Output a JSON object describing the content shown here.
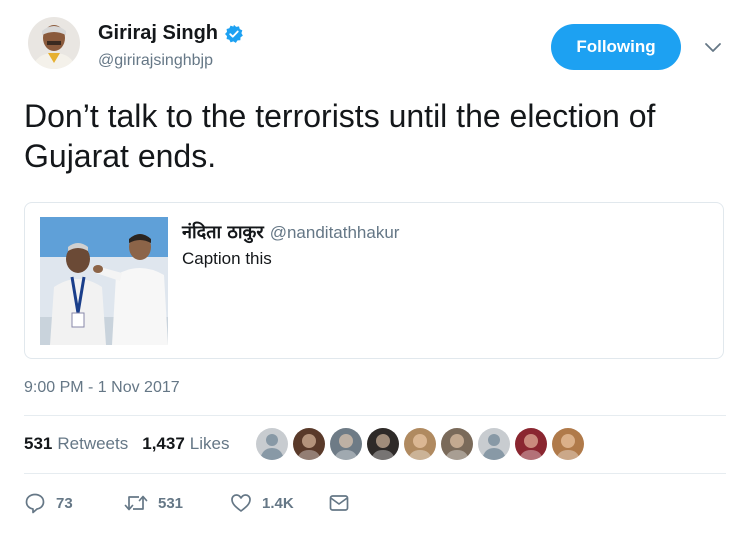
{
  "author": {
    "name": "Giriraj Singh",
    "handle": "@girirajsinghbjp",
    "avatar_icon": "profile-photo"
  },
  "follow_button": {
    "label": "Following",
    "color": "#1da1f2"
  },
  "tweet": {
    "text": "Don’t talk to the terrorists until the election of Gujarat ends."
  },
  "quoted_tweet": {
    "name": "नंदिता ठाकुर",
    "handle": "@nanditathhakur",
    "text": "Caption this"
  },
  "timestamp": "9:00 PM - 1 Nov 2017",
  "stats": {
    "retweets_count": "531",
    "retweets_label": "Retweets",
    "likes_count": "1,437",
    "likes_label": "Likes"
  },
  "actions": {
    "reply_count": "73",
    "retweet_count": "531",
    "like_count": "1.4K"
  },
  "liker_avatars": [
    "#c8ccd0",
    "#5a3a2a",
    "#6e7b86",
    "#2e2a28",
    "#b08a60",
    "#7a6a5a",
    "#c8ccd0",
    "#8a2630",
    "#b07a4a"
  ]
}
